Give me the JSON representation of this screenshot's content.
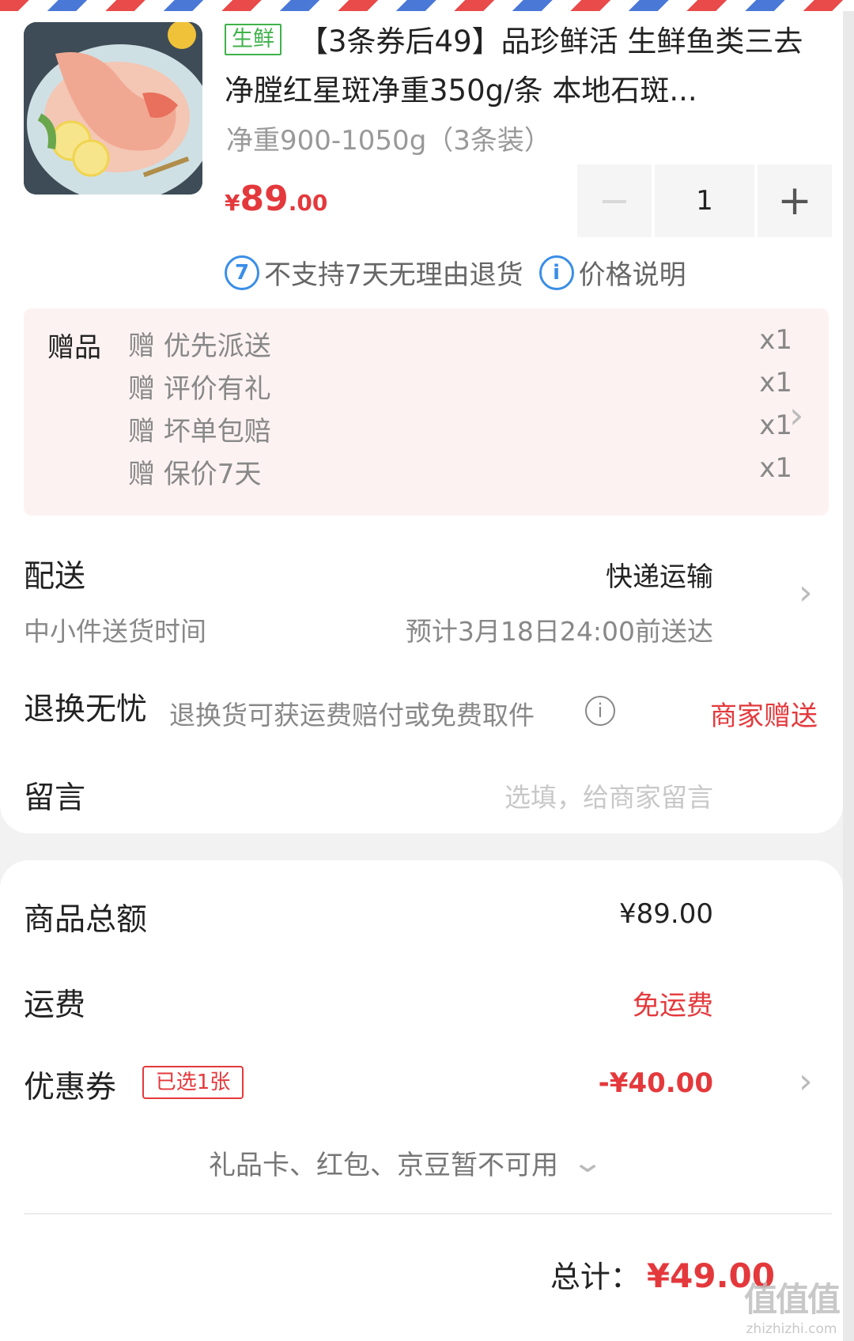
{
  "product": {
    "tag": "生鲜",
    "title": "【3条券后49】品珍鲜活 生鲜鱼类三去净膛红星斑净重350g/条 本地石斑...",
    "spec": "净重900-1050g（3条装）",
    "price_symbol": "¥",
    "price_int": "89",
    "price_dec": ".00",
    "quantity": "1",
    "minus": "−",
    "plus": "+",
    "no_return": "不支持7天无理由退货",
    "price_note": "价格说明"
  },
  "gifts": {
    "label": "赠品",
    "items": [
      {
        "text": "赠 优先派送",
        "qty": "x1"
      },
      {
        "text": "赠 评价有礼",
        "qty": "x1"
      },
      {
        "text": "赠 坏单包赔",
        "qty": "x1"
      },
      {
        "text": "赠 保价7天",
        "qty": "x1"
      }
    ]
  },
  "delivery": {
    "label": "配送",
    "method": "快递运输",
    "sub_label": "中小件送货时间",
    "eta": "预计3月18日24:00前送达"
  },
  "returns": {
    "label": "退换无忧",
    "desc": "退换货可获运费赔付或免费取件",
    "value": "商家赠送"
  },
  "message": {
    "label": "留言",
    "placeholder": "选填，给商家留言"
  },
  "summary": {
    "goods_label": "商品总额",
    "goods_value": "¥89.00",
    "shipping_label": "运费",
    "shipping_value": "免运费",
    "coupon_label": "优惠券",
    "coupon_badge": "已选1张",
    "coupon_value": "-¥40.00",
    "unavailable": "礼品卡、红包、京豆暂不可用",
    "total_label": "总计：",
    "total_value": "¥49.00"
  },
  "watermark": {
    "big": "值值值",
    "small": "zhizhizhi.com"
  },
  "colors": {
    "accent_red": "#e4393c",
    "fresh_green": "#3fb24a",
    "info_blue": "#3a8ee6",
    "gift_bg": "#fdf2f2"
  }
}
